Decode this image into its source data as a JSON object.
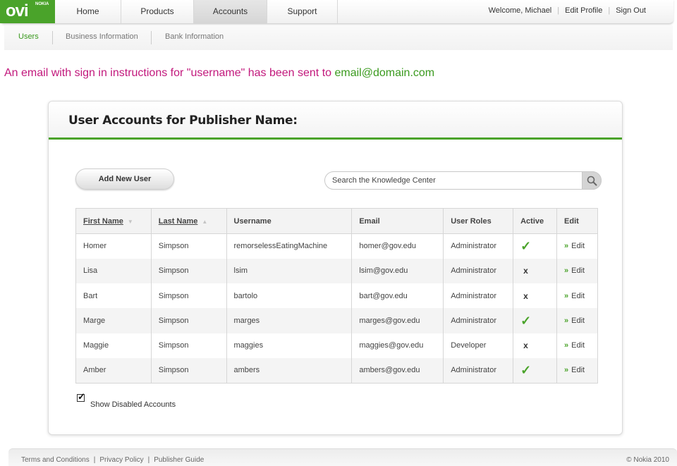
{
  "brand": {
    "logo": "ovi",
    "sub": "NOKIA",
    "green": "#4aa32a",
    "magenta": "#c2187c"
  },
  "nav": {
    "tabs": [
      {
        "label": "Home"
      },
      {
        "label": "Products"
      },
      {
        "label": "Accounts"
      },
      {
        "label": "Support"
      }
    ],
    "active_tab": "Accounts",
    "welcome": "Welcome, Michael",
    "edit_profile": "Edit Profile",
    "sign_out": "Sign Out"
  },
  "subnav": {
    "items": [
      {
        "label": "Users"
      },
      {
        "label": "Business Information"
      },
      {
        "label": "Bank Information"
      }
    ],
    "active": "Users"
  },
  "message": {
    "text": "An email with sign in instructions for \"username\" has been sent to",
    "email": "email@domain.com"
  },
  "panel": {
    "title": "User Accounts for Publisher Name:",
    "add_button": "Add New User",
    "search_placeholder": "Search the Knowledge Center",
    "search_icon": "magnifier-icon",
    "table": {
      "headers": [
        "First Name",
        "Last Name",
        "Username",
        "Email",
        "User Roles",
        "Active",
        "Edit"
      ],
      "rows": [
        {
          "first": "Homer",
          "last": "Simpson",
          "username": "remorselessEatingMachine",
          "email": "homer@gov.edu",
          "role": "Administrator",
          "active": "✓",
          "edit": "Edit"
        },
        {
          "first": "Lisa",
          "last": "Simpson",
          "username": "lsim",
          "email": "lsim@gov.edu",
          "role": "Administrator",
          "active": "x",
          "edit": "Edit"
        },
        {
          "first": "Bart",
          "last": "Simpson",
          "username": "bartolo",
          "email": "bart@gov.edu",
          "role": "Administrator",
          "active": "x",
          "edit": "Edit"
        },
        {
          "first": "Marge",
          "last": "Simpson",
          "username": "marges",
          "email": "marges@gov.edu",
          "role": "Administrator",
          "active": "✓",
          "edit": "Edit"
        },
        {
          "first": "Maggie",
          "last": "Simpson",
          "username": "maggies",
          "email": "maggies@gov.edu",
          "role": "Developer",
          "active": "x",
          "edit": "Edit"
        },
        {
          "first": "Amber",
          "last": "Simpson",
          "username": "ambers",
          "email": "ambers@gov.edu",
          "role": "Administrator",
          "active": "✓",
          "edit": "Edit"
        }
      ]
    },
    "show_disabled_label": "Show Disabled Accounts",
    "show_disabled_checked": true
  },
  "footer": {
    "links": [
      "Terms and Conditions",
      "Privacy Policy",
      "Publisher Guide"
    ],
    "copyright": "© Nokia 2010"
  }
}
